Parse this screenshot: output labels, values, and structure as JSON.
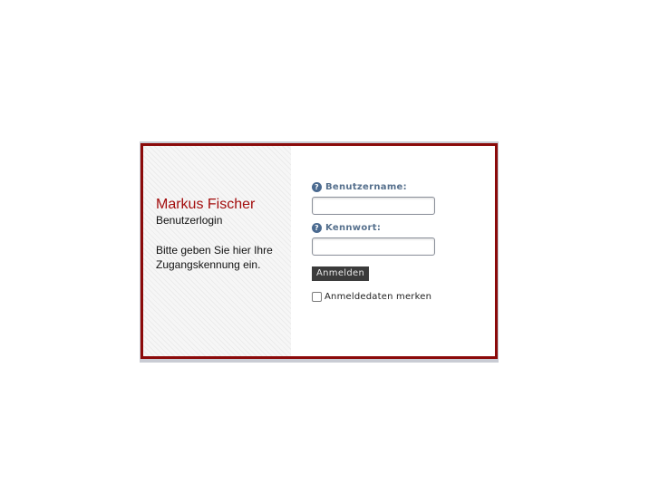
{
  "info": {
    "name": "Markus Fischer",
    "subtitle": "Benutzerlogin",
    "instruction": "Bitte geben Sie hier Ihre Zugangskennung ein."
  },
  "form": {
    "username_label": "Benutzername:",
    "username_value": "",
    "password_label": "Kennwort:",
    "password_value": "",
    "submit_label": "Anmelden",
    "remember_label": "Anmeldedaten merken",
    "remember_checked": false
  },
  "icons": {
    "help": "help-icon"
  },
  "colors": {
    "border": "#8b0a0a",
    "name": "#a30d0d",
    "label": "#56708d",
    "button": "#3b3b3b"
  }
}
